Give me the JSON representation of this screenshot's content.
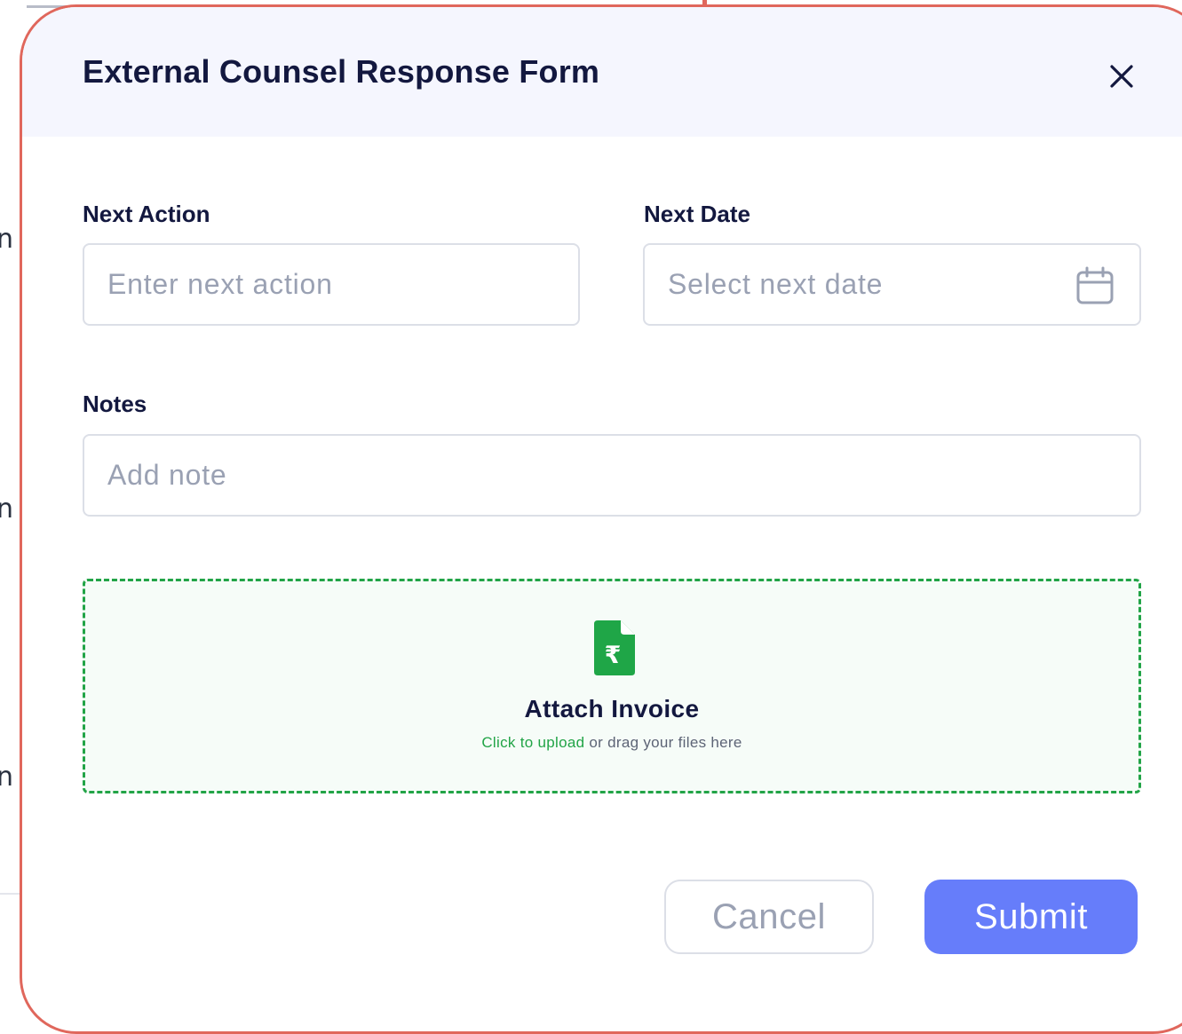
{
  "modal": {
    "title": "External Counsel Response Form"
  },
  "form": {
    "next_action": {
      "label": "Next Action",
      "placeholder": "Enter next action",
      "value": ""
    },
    "next_date": {
      "label": "Next Date",
      "placeholder": "Select next date",
      "value": ""
    },
    "notes": {
      "label": "Notes",
      "placeholder": "Add note",
      "value": ""
    }
  },
  "upload": {
    "title": "Attach Invoice",
    "link_text": "Click to upload",
    "hint_text": " or drag your files here"
  },
  "actions": {
    "cancel_label": "Cancel",
    "submit_label": "Submit"
  },
  "background": {
    "letters": [
      "n",
      "n",
      "n"
    ]
  },
  "colors": {
    "accent": "#667dfa",
    "upload_green": "#22a447",
    "modal_border": "#e0675c",
    "title_text": "#13183f"
  },
  "icons": {
    "close": "close-icon",
    "calendar": "calendar-icon",
    "invoice": "rupee-file-icon"
  }
}
